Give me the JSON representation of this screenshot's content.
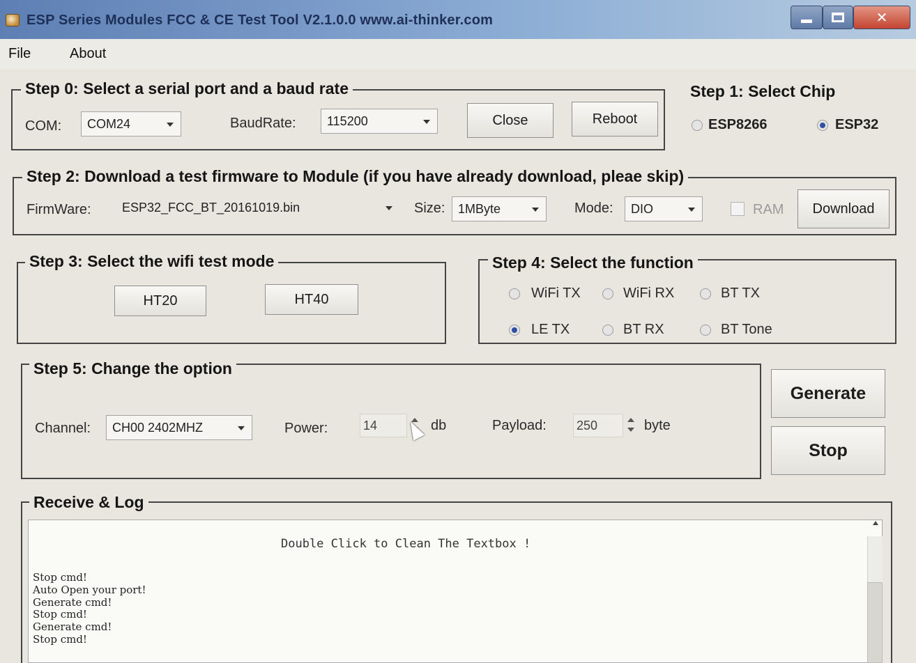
{
  "window": {
    "title": "ESP Series Modules FCC & CE Test Tool  V2.1.0.0    www.ai-thinker.com"
  },
  "menu": {
    "file": "File",
    "about": "About"
  },
  "step0": {
    "title": "Step 0: Select a serial port and a baud rate",
    "com_label": "COM:",
    "com_value": "COM24",
    "baud_label": "BaudRate:",
    "baud_value": "115200",
    "close_label": "Close",
    "reboot_label": "Reboot"
  },
  "step1": {
    "title": "Step 1: Select Chip",
    "options": [
      {
        "label": "ESP8266",
        "selected": false
      },
      {
        "label": "ESP32",
        "selected": true
      }
    ]
  },
  "step2": {
    "title": "Step 2: Download a test firmware to Module  (if you have already download, pleae skip)",
    "firmware_label": "FirmWare:",
    "firmware_value": "ESP32_FCC_BT_20161019.bin",
    "size_label": "Size:",
    "size_value": "1MByte",
    "mode_label": "Mode:",
    "mode_value": "DIO",
    "ram_label": "RAM",
    "ram_checked": false,
    "download_label": "Download"
  },
  "step3": {
    "title": "Step 3: Select the wifi test mode",
    "ht20_label": "HT20",
    "ht40_label": "HT40"
  },
  "step4": {
    "title": "Step 4: Select the function",
    "options": [
      {
        "label": "WiFi TX",
        "selected": false
      },
      {
        "label": "WiFi RX",
        "selected": false
      },
      {
        "label": "BT TX",
        "selected": false
      },
      {
        "label": "LE TX",
        "selected": true
      },
      {
        "label": "BT RX",
        "selected": false
      },
      {
        "label": "BT Tone",
        "selected": false
      }
    ]
  },
  "step5": {
    "title": "Step 5: Change the option",
    "channel_label": "Channel:",
    "channel_value": "CH00 2402MHZ",
    "power_label": "Power:",
    "power_value": "14",
    "power_unit": "db",
    "payload_label": "Payload:",
    "payload_value": "250",
    "payload_unit": "byte"
  },
  "actions": {
    "generate_label": "Generate",
    "stop_label": "Stop"
  },
  "log": {
    "title": "Receive & Log",
    "hint": "Double Click to Clean The Textbox !",
    "lines": [
      "Stop cmd!",
      "Auto Open your port!",
      "Generate cmd!",
      "Stop cmd!",
      "Generate cmd!",
      "Stop cmd!"
    ]
  },
  "colors": {
    "accent": "#2f4fa3",
    "window_bg": "#e9e6df",
    "close_button": "#c44430"
  }
}
